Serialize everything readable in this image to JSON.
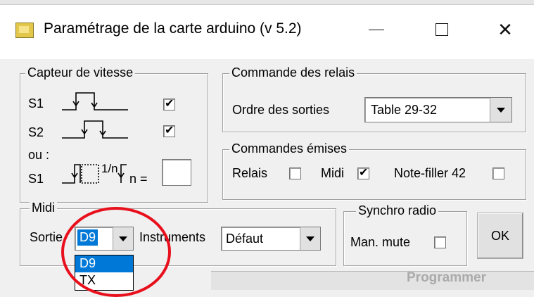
{
  "window": {
    "title": "Paramétrage de la carte arduino (v 5.2)",
    "minimize": "—",
    "close": "✕"
  },
  "capteur": {
    "title": "Capteur de vitesse",
    "s1": "S1",
    "s2": "S2",
    "ou": "ou :",
    "s1b": "S1",
    "frac": "1/n",
    "n_label": "n =",
    "n_value": "",
    "s1_checked": true,
    "s2_checked": true
  },
  "relais": {
    "title": "Commande des relais",
    "ordre_label": "Ordre des sorties",
    "ordre_value": "Table 29-32"
  },
  "emises": {
    "title": "Commandes émises",
    "relais_label": "Relais",
    "relais_checked": false,
    "midi_label": "Midi",
    "midi_checked": true,
    "notefiller_label": "Note-filler 42",
    "notefiller_checked": false
  },
  "midi": {
    "title": "Midi",
    "sortie_label": "Sortie",
    "sortie_value": "D9",
    "instruments_label": "Instruments",
    "instruments_value": "Défaut",
    "sortie_options": [
      "D9",
      "TX"
    ]
  },
  "synchro": {
    "title": "Synchro radio",
    "man_mute_label": "Man. mute",
    "man_mute_checked": false
  },
  "ok_label": "OK",
  "background": {
    "partial_text": "Programmer"
  },
  "colors": {
    "selection": "#0078d7",
    "annotation": "#e8101c"
  }
}
